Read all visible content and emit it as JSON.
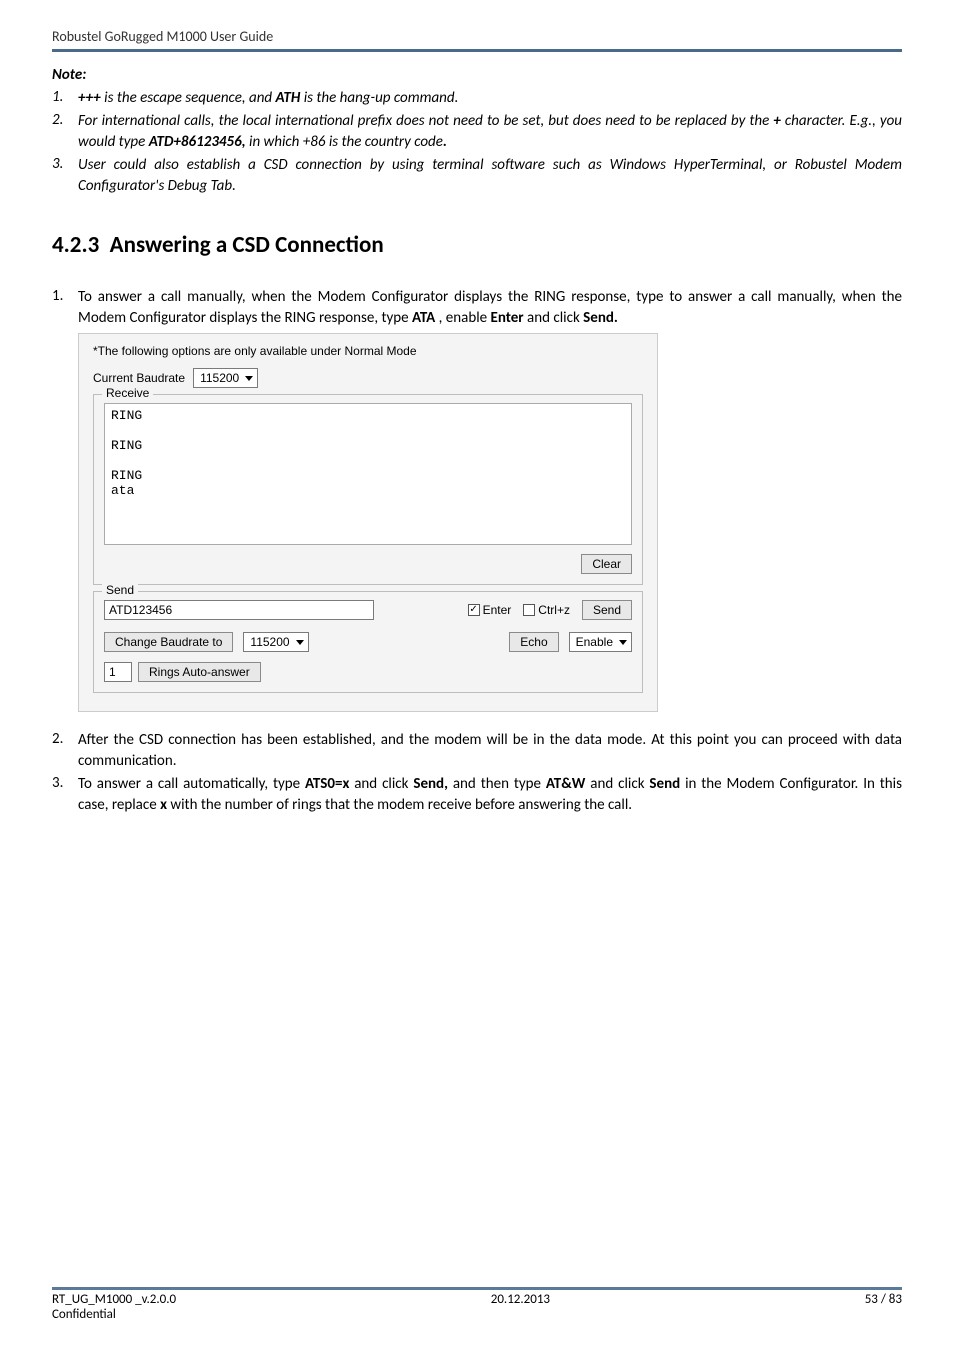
{
  "header": {
    "doc_title": "Robustel GoRugged M1000 User Guide"
  },
  "note": {
    "label": "Note",
    "items": [
      {
        "num": "1.",
        "pre": "",
        "b1": "+++",
        "mid1": " is the escape sequence, and ",
        "b2": "ATH",
        "mid2": " is the hang-up command.",
        "b3": "",
        "post": ""
      },
      {
        "num": "2.",
        "pre": "For international calls, the local international prefix does not need to be set, but does need to be replaced by the ",
        "b1": "+",
        "mid1": " character. E.g., you would type ",
        "b2": "ATD+86123456,",
        "mid2": " in which +86 is the country code",
        "b3": ".",
        "post": ""
      },
      {
        "num": "3.",
        "pre": "User could also establish a CSD connection by using terminal software such as Windows HyperTerminal, or Robustel Modem Configurator's Debug Tab.",
        "b1": "",
        "mid1": "",
        "b2": "",
        "mid2": "",
        "b3": "",
        "post": ""
      }
    ]
  },
  "section": {
    "number": "4.2.3",
    "title": "Answering a CSD Connection"
  },
  "body_items": [
    {
      "num": "1.",
      "text_pre": "To answer a call manually, when the Modem Configurator displays the RING response, type to answer a call manually, when the Modem Configurator displays the RING response, type ",
      "b1": "ATA",
      "mid1": " , enable ",
      "b2": "Enter",
      "mid2": " and click ",
      "b3": "Send.",
      "post": ""
    },
    {
      "num": "2.",
      "text_pre": "After the CSD connection has been established, and the modem will be in the data mode. At this point you can proceed with data communication.",
      "b1": "",
      "mid1": "",
      "b2": "",
      "mid2": "",
      "b3": "",
      "post": ""
    },
    {
      "num": "3.",
      "text_pre": "To answer a call automatically, type ",
      "b1": "ATS0=x",
      "mid1": " and click ",
      "b2": "Send,",
      "mid2": " and then type ",
      "b3": "AT&W",
      "post_mid": " and click ",
      "b4": "Send",
      "post_mid2": " in the Modem Configurator. In this case, replace ",
      "b5": "x",
      "post": " with the number of rings that the modem receive before answering the call."
    }
  ],
  "panel": {
    "hint": "*The following options are only available under Normal Mode",
    "current_baud_label": "Current Baudrate",
    "current_baud_value": "115200",
    "receive_legend": "Receive",
    "receive_text": "RING\n\nRING\n\nRING\nata",
    "clear_btn": "Clear",
    "send_legend": "Send",
    "send_input_value": "ATD123456",
    "enter_label": "Enter",
    "enter_checked": true,
    "ctrlz_label": "Ctrl+z",
    "ctrlz_checked": false,
    "send_btn": "Send",
    "change_baud_btn": "Change Baudrate to",
    "change_baud_value": "115200",
    "echo_btn": "Echo",
    "echo_select": "Enable",
    "rings_value": "1",
    "rings_btn": "Rings Auto-answer"
  },
  "footer": {
    "left": "RT_UG_M1000 _v.2.0.0",
    "center": "20.12.2013",
    "right": "53 / 83",
    "conf": "Confidential"
  }
}
